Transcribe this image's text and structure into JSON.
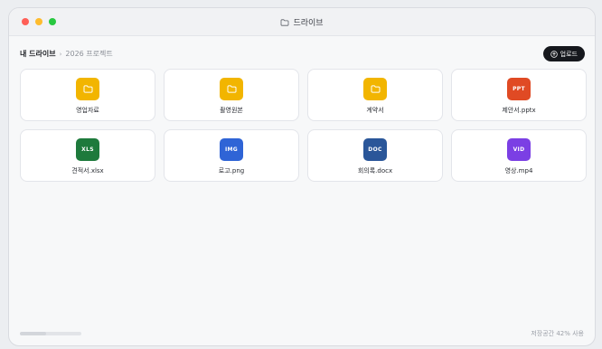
{
  "window": {
    "title": "드라이브"
  },
  "breadcrumb": {
    "root": "내 드라이브",
    "separator": "›",
    "current": "2026 프로젝트"
  },
  "toolbar": {
    "upload_label": "업로드"
  },
  "items": [
    {
      "name": "영업자료",
      "kind": "folder",
      "badge": "",
      "color": "#f2b500"
    },
    {
      "name": "촬영원본",
      "kind": "folder",
      "badge": "",
      "color": "#f2b500"
    },
    {
      "name": "계약서",
      "kind": "folder",
      "badge": "",
      "color": "#f2b500"
    },
    {
      "name": "제안서.pptx",
      "kind": "file",
      "badge": "PPT",
      "color": "#e04a24"
    },
    {
      "name": "견적서.xlsx",
      "kind": "file",
      "badge": "XLS",
      "color": "#1e7a3c"
    },
    {
      "name": "로고.png",
      "kind": "file",
      "badge": "IMG",
      "color": "#2f64d6"
    },
    {
      "name": "회의록.docx",
      "kind": "file",
      "badge": "DOC",
      "color": "#2a5699"
    },
    {
      "name": "영상.mp4",
      "kind": "file",
      "badge": "VID",
      "color": "#7b3fe4"
    }
  ],
  "footer": {
    "storage_text": "저장공간 42% 사용",
    "storage_used_percent": 42
  }
}
